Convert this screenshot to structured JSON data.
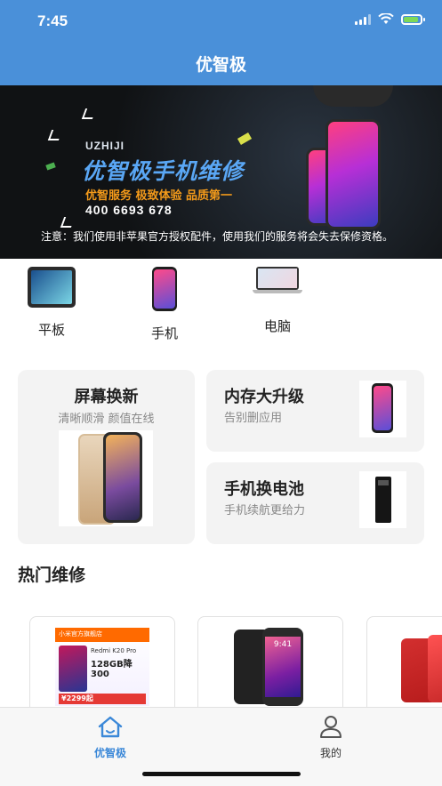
{
  "status_bar": {
    "time": "7:45"
  },
  "nav": {
    "title": "优智极"
  },
  "banner": {
    "brand": "UZHIJI",
    "title": "优智极手机维修",
    "slogan": "优智服务  极致体验  品质第一",
    "phone": "400 6693 678",
    "notice": "注意：我们使用非苹果官方授权配件，使用我们的服务将会失去保修资格。"
  },
  "categories": [
    {
      "label": "平板",
      "icon": "tablet-icon"
    },
    {
      "label": "手机",
      "icon": "phone-icon"
    },
    {
      "label": "电脑",
      "icon": "laptop-icon"
    }
  ],
  "services": {
    "screen": {
      "title": "屏幕换新",
      "subtitle": "清晰顺滑 颜值在线"
    },
    "storage": {
      "title": "内存大升级",
      "subtitle": "告别删应用"
    },
    "battery": {
      "title": "手机换电池",
      "subtitle": "手机续航更给力"
    }
  },
  "hot": {
    "title": "热门维修",
    "items": [
      {
        "lines": [
          "小米官方旗舰店",
          "Redmi K20 Pro",
          "128GB降300",
          "¥2299起"
        ]
      },
      {
        "lines": [
          "9:41"
        ]
      },
      {
        "lines": []
      }
    ]
  },
  "tabbar": {
    "home": {
      "label": "优智极",
      "icon": "home-icon"
    },
    "mine": {
      "label": "我的",
      "icon": "user-icon"
    }
  },
  "colors": {
    "primary": "#4a90d9",
    "tab_active": "#3b88d8",
    "banner_title": "#5aa7f5",
    "banner_slogan": "#f39a1a"
  }
}
